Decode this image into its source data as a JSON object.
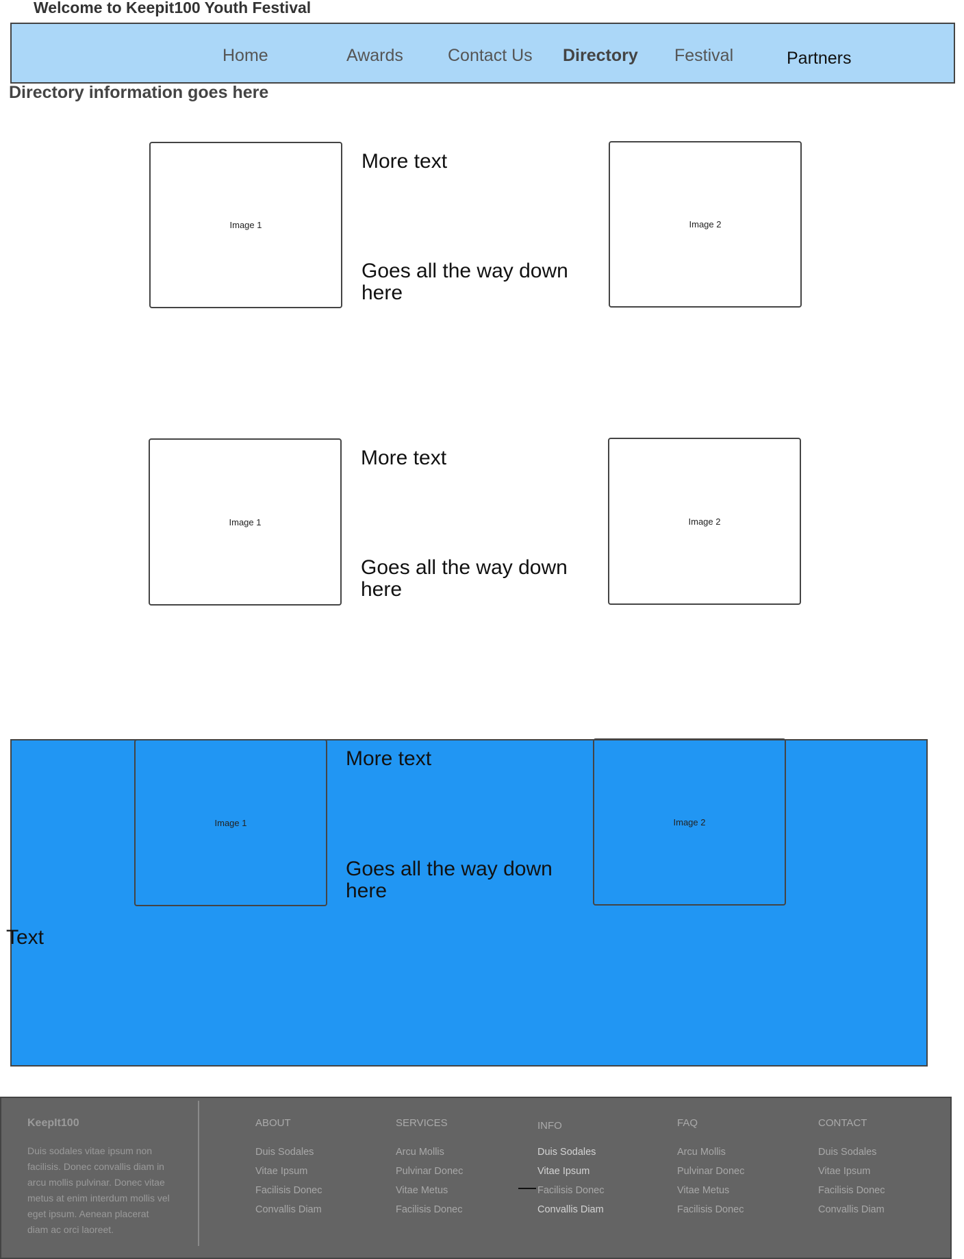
{
  "header": {
    "site_title": "Welcome to Keepit100 Youth Festival"
  },
  "nav": {
    "items": [
      {
        "label": "Home"
      },
      {
        "label": "Awards"
      },
      {
        "label": "Contact Us"
      },
      {
        "label": "Directory"
      },
      {
        "label": "Festival"
      },
      {
        "label": "Partners"
      }
    ]
  },
  "main": {
    "heading": "Directory information goes here",
    "rows": [
      {
        "image1": "Image 1",
        "image2": "Image 2",
        "text_top": "More text",
        "text_bottom": "Goes all the way down here"
      },
      {
        "image1": "Image 1",
        "image2": "Image 2",
        "text_top": "More text",
        "text_bottom": "Goes all the way down here"
      },
      {
        "image1": "Image 1",
        "image2": "Image 2",
        "text_top": "More text",
        "text_bottom": "Goes all the way down here"
      }
    ],
    "panel_text": "Text"
  },
  "footer": {
    "brand": "KeepIt100",
    "description": "Duis sodales vitae ipsum non facilisis. Donec convallis diam in arcu mollis pulvinar. Donec vitae metus at enim interdum mollis vel eget ipsum. Aenean placerat diam ac orci laoreet.",
    "columns": [
      {
        "title": "ABOUT",
        "links": [
          "Duis Sodales",
          "Vitae Ipsum",
          "Facilisis Donec",
          "Convallis Diam"
        ]
      },
      {
        "title": "SERVICES",
        "links": [
          "Arcu Mollis",
          "Pulvinar Donec",
          "Vitae Metus",
          "Facilisis Donec"
        ]
      },
      {
        "title": "INFO",
        "links": [
          "Duis Sodales",
          "Vitae Ipsum",
          "Facilisis Donec",
          "Convallis Diam"
        ]
      },
      {
        "title": "FAQ",
        "links": [
          "Arcu Mollis",
          "Pulvinar Donec",
          "Vitae Metus",
          "Facilisis Donec"
        ]
      },
      {
        "title": "CONTACT",
        "links": [
          "Duis Sodales",
          "Vitae Ipsum",
          "Facilisis Donec",
          "Convallis Diam"
        ]
      }
    ]
  },
  "colors": {
    "nav_background": "#abd7f8",
    "panel_background": "#2196f3",
    "footer_background": "#646464"
  }
}
